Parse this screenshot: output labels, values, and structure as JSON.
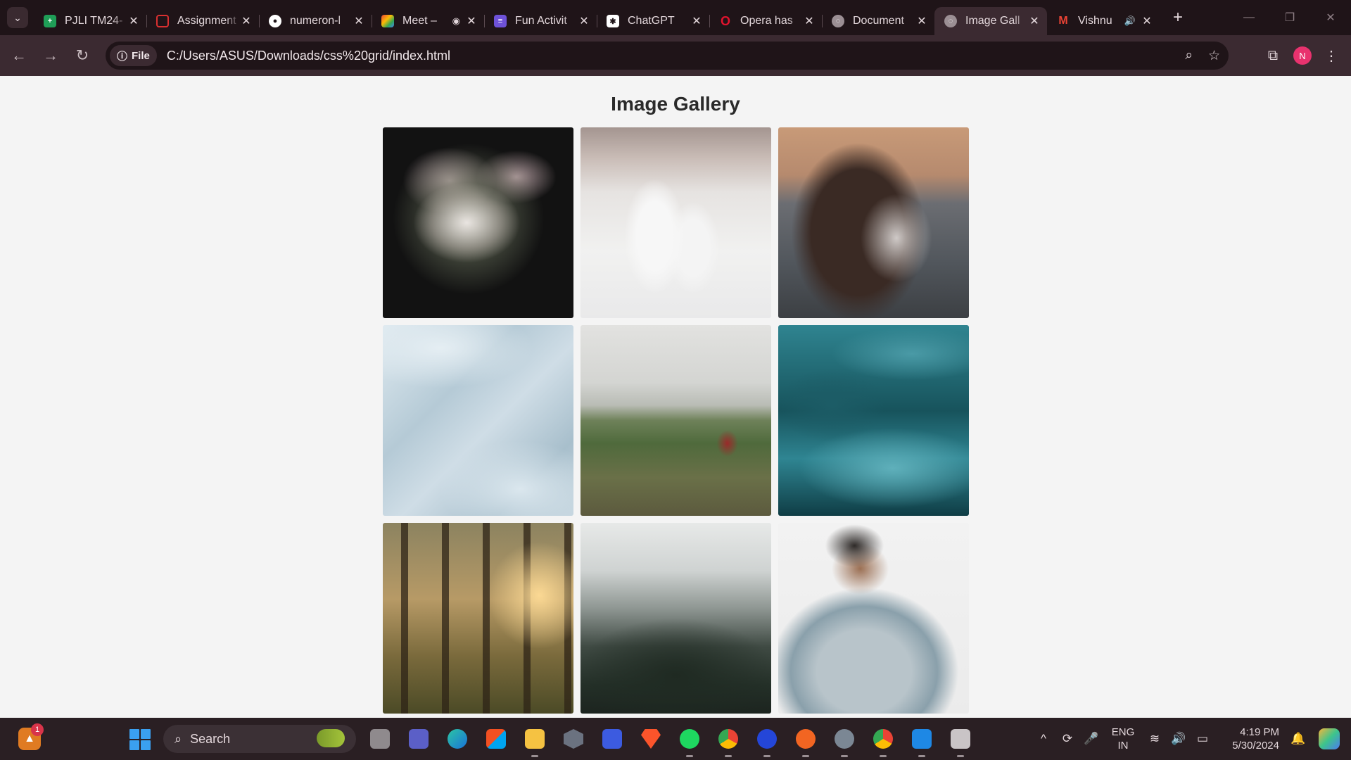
{
  "browser": {
    "tabs": [
      {
        "title": "PJLI TM24-",
        "icon": "sheets-icon",
        "color": "#1f9e57"
      },
      {
        "title": "Assignment",
        "icon": "assignment-icon",
        "color": "#d93030"
      },
      {
        "title": "numeron-l",
        "icon": "github-icon",
        "color": "#ffffff"
      },
      {
        "title": "Meet –",
        "icon": "meet-icon",
        "color": "#0f9d58",
        "extra": "◉"
      },
      {
        "title": "Fun Activit",
        "icon": "forms-icon",
        "color": "#6e52d8"
      },
      {
        "title": "ChatGPT",
        "icon": "chatgpt-icon",
        "color": "#ffffff"
      },
      {
        "title": "Opera has",
        "icon": "opera-icon",
        "color": "#e1132d"
      },
      {
        "title": "Document",
        "icon": "globe-icon",
        "color": "#9b8f94"
      },
      {
        "title": "Image Gall",
        "icon": "globe-icon",
        "color": "#9b8f94",
        "active": true
      },
      {
        "title": "Vishnu",
        "icon": "gmail-icon",
        "color": "#ea4335",
        "extra": "🔊"
      }
    ],
    "new_tab": "+",
    "chip_label": "File",
    "url": "C:/Users/ASUS/Downloads/css%20grid/index.html",
    "profile_initial": "N"
  },
  "page": {
    "title": "Image Gallery",
    "images": [
      {
        "subject": "flowers"
      },
      {
        "subject": "dogs"
      },
      {
        "subject": "couple"
      },
      {
        "subject": "swirl"
      },
      {
        "subject": "hill"
      },
      {
        "subject": "teal-waves"
      },
      {
        "subject": "forest"
      },
      {
        "subject": "foggy-forest"
      },
      {
        "subject": "man-sunglasses"
      }
    ]
  },
  "taskbar": {
    "search_placeholder": "Search",
    "notification_count": "1",
    "lang_line1": "ENG",
    "lang_line2": "IN",
    "time": "4:19 PM",
    "date": "5/30/2024"
  }
}
